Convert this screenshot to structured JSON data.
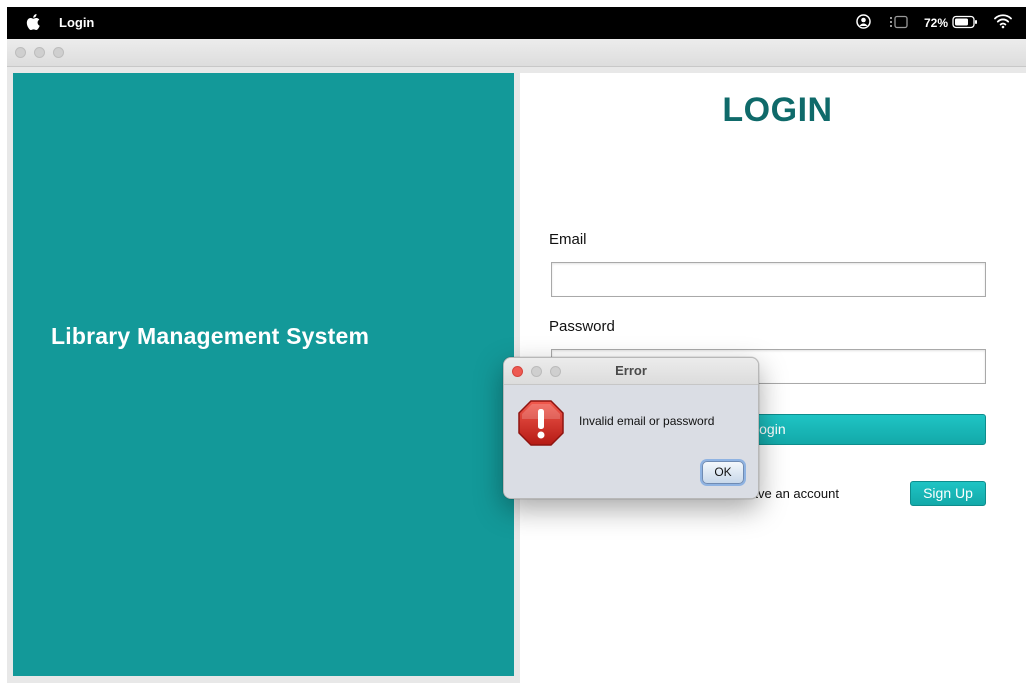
{
  "menubar": {
    "app_title": "Login",
    "battery_percent": "72%",
    "icons": [
      "apple-icon",
      "user-icon",
      "focus-icon",
      "battery-icon",
      "wifi-icon"
    ]
  },
  "left_panel": {
    "title": "Library Management System",
    "background_color": "#139999"
  },
  "login_form": {
    "heading": "LOGIN",
    "heading_color": "#0f6a6a",
    "email_label": "Email",
    "email_value": "",
    "password_label": "Password",
    "password_value": "",
    "login_button_label": "Login",
    "no_account_text": "Don't have an account",
    "signup_button_label": "Sign Up",
    "accent_color": "#1bb8b8"
  },
  "error_dialog": {
    "title": "Error",
    "message": "Invalid email or password",
    "ok_label": "OK",
    "icon": "stop-icon"
  }
}
